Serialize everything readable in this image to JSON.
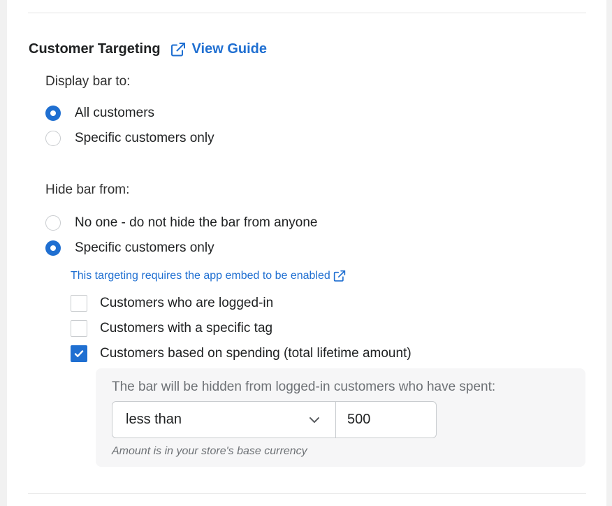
{
  "section": {
    "title": "Customer Targeting",
    "guide_link": "View Guide"
  },
  "display": {
    "label": "Display bar to:",
    "options": [
      {
        "label": "All customers",
        "checked": true
      },
      {
        "label": "Specific customers only",
        "checked": false
      }
    ]
  },
  "hide": {
    "label": "Hide bar from:",
    "options": [
      {
        "label": "No one - do not hide the bar from anyone",
        "checked": false
      },
      {
        "label": "Specific customers only",
        "checked": true
      }
    ],
    "embed_note": "This targeting requires the app embed to be enabled",
    "checkboxes": [
      {
        "label": "Customers who are logged-in",
        "checked": false
      },
      {
        "label": "Customers with a specific tag",
        "checked": false
      },
      {
        "label": "Customers based on spending (total lifetime amount)",
        "checked": true
      }
    ]
  },
  "spending": {
    "description": "The bar will be hidden from logged-in customers who have spent:",
    "comparison": "less than",
    "amount": "500",
    "help": "Amount is in your store's base currency"
  },
  "colors": {
    "accent": "#1f6fd1",
    "border": "#c9cccf",
    "panel_bg": "#f6f6f7"
  },
  "icons": {
    "guide": "external-link-icon",
    "note": "external-link-icon",
    "select": "chevron-down-icon",
    "check": "checkmark-icon"
  }
}
